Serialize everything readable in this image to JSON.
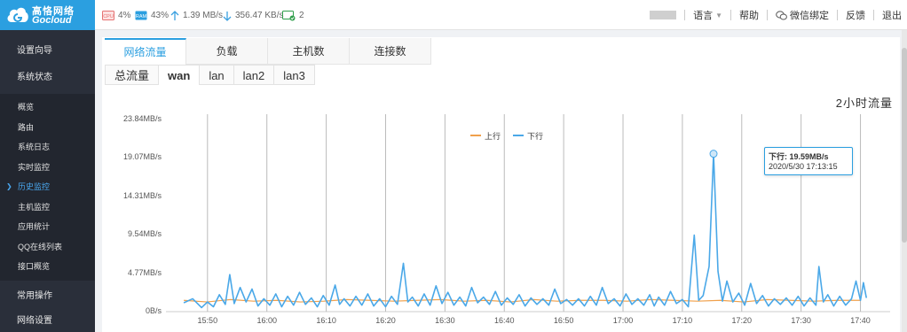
{
  "logo": {
    "name_cn": "高恪网络",
    "name_en": "Gocloud"
  },
  "status": {
    "cpu_label": "CPU",
    "cpu": "4%",
    "ram_label": "RAM",
    "ram": "43%",
    "upload": "1.39 MB/s",
    "download": "356.47 KB/s",
    "online": "2"
  },
  "topnav": {
    "language": "语言",
    "help": "帮助",
    "wechat": "微信绑定",
    "feedback": "反馈",
    "logout": "退出"
  },
  "sidebar": {
    "setup": "设置向导",
    "system_status": "系统状态",
    "items": [
      "概览",
      "路由",
      "系统日志",
      "实时监控",
      "历史监控",
      "主机监控",
      "应用统计",
      "QQ在线列表",
      "接口概览"
    ],
    "active_index": 4,
    "common_ops": "常用操作",
    "network_settings": "网络设置"
  },
  "tabs": [
    "网络流量",
    "负载",
    "主机数",
    "连接数"
  ],
  "subtabs": [
    "总流量",
    "wan",
    "lan",
    "lan2",
    "lan3"
  ],
  "chart_title": "2小时流量",
  "tooltip": {
    "line1": "下行: 19.59MB/s",
    "line2": "2020/5/30 17:13:15"
  },
  "colors": {
    "upload": "#f0a04b",
    "download": "#4aa8e8",
    "accent": "#2b9fe0"
  },
  "chart_data": {
    "type": "line",
    "title": "2小时流量",
    "y_unit": "MB/s",
    "yticks": [
      "0B/s",
      "4.77MB/s",
      "9.54MB/s",
      "14.31MB/s",
      "19.07MB/s",
      "23.84MB/s"
    ],
    "ylim": [
      0,
      23.84
    ],
    "xticks": [
      "15:50",
      "16:00",
      "16:10",
      "16:20",
      "16:30",
      "16:40",
      "16:50",
      "17:00",
      "17:10",
      "17:20",
      "17:30",
      "17:40"
    ],
    "x_range": [
      "15:43",
      "17:45"
    ],
    "legend": [
      "上行",
      "下行"
    ],
    "legend_position": "top-center",
    "grid": true,
    "series": [
      {
        "name": "上行",
        "color": "#f0a04b",
        "baseline": 1.39,
        "values": [
          1.4,
          1.2,
          1.5,
          1.3,
          1.4,
          1.2,
          1.3,
          1.5,
          1.4,
          1.3,
          1.4,
          1.5,
          1.3,
          1.4,
          1.2,
          1.5,
          1.3,
          1.4,
          1.4,
          1.3,
          1.5,
          1.4,
          1.3,
          1.4,
          1.2,
          1.5,
          1.4,
          1.3,
          1.4,
          1.4
        ]
      },
      {
        "name": "下行",
        "color": "#4aa8e8",
        "points": [
          [
            0,
            1.1
          ],
          [
            3,
            1.6
          ],
          [
            6,
            0.5
          ],
          [
            8,
            1.2
          ],
          [
            10,
            0.6
          ],
          [
            12,
            2.1
          ],
          [
            14,
            0.9
          ],
          [
            15.5,
            4.6
          ],
          [
            17,
            1.0
          ],
          [
            19,
            3.0
          ],
          [
            21,
            1.2
          ],
          [
            23,
            2.8
          ],
          [
            25,
            0.7
          ],
          [
            27,
            1.6
          ],
          [
            29,
            0.8
          ],
          [
            31,
            2.2
          ],
          [
            33,
            0.6
          ],
          [
            35,
            1.9
          ],
          [
            37,
            0.8
          ],
          [
            39,
            2.4
          ],
          [
            41,
            0.9
          ],
          [
            43,
            1.7
          ],
          [
            45,
            0.6
          ],
          [
            47,
            2.0
          ],
          [
            49,
            0.8
          ],
          [
            51,
            3.3
          ],
          [
            52.5,
            0.9
          ],
          [
            54,
            1.6
          ],
          [
            56,
            0.7
          ],
          [
            58,
            1.9
          ],
          [
            60,
            0.8
          ],
          [
            62,
            2.2
          ],
          [
            64,
            0.7
          ],
          [
            66,
            1.6
          ],
          [
            68,
            0.6
          ],
          [
            70,
            1.9
          ],
          [
            72,
            0.9
          ],
          [
            74,
            6.0
          ],
          [
            75.5,
            1.2
          ],
          [
            77,
            1.8
          ],
          [
            79,
            0.7
          ],
          [
            81,
            2.2
          ],
          [
            83,
            0.8
          ],
          [
            85,
            3.2
          ],
          [
            87,
            1.0
          ],
          [
            89,
            2.4
          ],
          [
            91,
            0.8
          ],
          [
            93,
            1.8
          ],
          [
            95,
            0.7
          ],
          [
            97,
            3.0
          ],
          [
            99,
            1.1
          ],
          [
            101,
            1.8
          ],
          [
            103,
            0.9
          ],
          [
            105,
            2.5
          ],
          [
            107,
            0.8
          ],
          [
            109,
            1.7
          ],
          [
            111,
            0.9
          ],
          [
            113,
            2.1
          ],
          [
            115,
            0.7
          ],
          [
            117,
            1.7
          ],
          [
            119,
            0.9
          ],
          [
            121,
            1.6
          ],
          [
            123,
            0.8
          ],
          [
            125,
            2.8
          ],
          [
            127,
            1.0
          ],
          [
            129,
            1.5
          ],
          [
            131,
            0.8
          ],
          [
            133,
            1.6
          ],
          [
            135,
            0.7
          ],
          [
            137,
            1.9
          ],
          [
            139,
            0.8
          ],
          [
            141,
            3.0
          ],
          [
            143,
            1.0
          ],
          [
            145,
            1.6
          ],
          [
            147,
            0.7
          ],
          [
            149,
            2.2
          ],
          [
            151,
            0.9
          ],
          [
            153,
            1.6
          ],
          [
            155,
            0.8
          ],
          [
            157,
            2.1
          ],
          [
            158.5,
            0.7
          ],
          [
            160,
            1.8
          ],
          [
            162,
            0.8
          ],
          [
            164,
            2.5
          ],
          [
            166,
            1.0
          ],
          [
            168,
            1.5
          ],
          [
            170,
            0.6
          ],
          [
            172,
            9.5
          ],
          [
            173.5,
            1.4
          ],
          [
            175,
            2.0
          ],
          [
            177,
            5.6
          ],
          [
            178.5,
            19.59
          ],
          [
            180,
            5.0
          ],
          [
            181.5,
            1.3
          ],
          [
            183,
            3.8
          ],
          [
            185,
            1.2
          ],
          [
            187,
            2.3
          ],
          [
            189,
            0.8
          ],
          [
            191,
            3.5
          ],
          [
            193,
            1.0
          ],
          [
            195,
            2.0
          ],
          [
            197,
            0.7
          ],
          [
            199,
            1.6
          ],
          [
            201,
            0.9
          ],
          [
            203,
            1.7
          ],
          [
            205,
            0.8
          ],
          [
            207,
            1.9
          ],
          [
            209,
            0.7
          ],
          [
            211,
            1.7
          ],
          [
            213,
            0.8
          ],
          [
            214,
            5.6
          ],
          [
            215.5,
            1.2
          ],
          [
            217,
            2.1
          ],
          [
            219,
            0.7
          ],
          [
            221,
            1.9
          ],
          [
            223,
            0.8
          ],
          [
            225,
            1.6
          ],
          [
            226.5,
            3.8
          ],
          [
            228,
            1.4
          ],
          [
            229,
            3.6
          ],
          [
            230,
            1.7
          ]
        ]
      }
    ],
    "annotation": {
      "label": "下行: 19.59MB/s",
      "time": "2020/5/30 17:13:15",
      "value": 19.59
    }
  }
}
